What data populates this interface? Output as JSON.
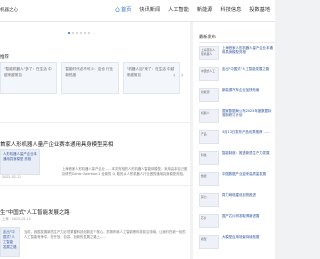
{
  "header": {
    "logo_text": "机器之心",
    "nav": [
      {
        "label": "首页",
        "active": true
      },
      {
        "label": "快讯新闻",
        "active": false
      },
      {
        "label": "人工智能",
        "active": false
      },
      {
        "label": "新能源",
        "active": false
      },
      {
        "label": "科技信息",
        "active": false
      },
      {
        "label": "投数基地",
        "active": false
      }
    ]
  },
  "main": {
    "section_label": "推荐",
    "carousel": [
      {
        "caption": "\"智能机器人\"多了：在生活 中越来越常见"
      },
      {
        "caption": "智能时代必不可少：这也 行业新热度"
      },
      {
        "caption": "\"机器人加\"来了：在生活 中越来越常见"
      }
    ],
    "articles": [
      {
        "title": "首家人形机器人量产企业赛本通用具身模型亮相",
        "thumb_caption": "人形机器人量产企业本通用具身模型 亮相",
        "meta": "2025-02-11",
        "summary": "上海首家人形机器人量产企业……本次亮相的人形机器人智能体模型，采用由本自己团队研究Genie Operator-1 全新的 以  取的从人形机器人行业做的通用具身模型亮相。"
      },
      {
        "title": "生\"中国式\"人工智能发展之路",
        "thumb_caption": "走出\"中国式\"人工智能 发展之路",
        "meta": "上海 · 2025-02-11",
        "summary": "当前，我国发展新质生产力必须紧握科技创新这个核心，抓紧布局人工智能等科技前沿领域，让我们在新一轮的人工智能竞争中，在开放、包容、创新的发展之路上……"
      }
    ]
  },
  "sidebar": {
    "heading": "最新发布",
    "items": [
      {
        "thumb": "上海首家人形机器人",
        "text": "上海首家人形机器人量产企业本通用具身模型亮相"
      },
      {
        "thumb": "中国式人工",
        "text": "走出\"中国式\"人工智能发展之路"
      },
      {
        "thumb": "新能源",
        "text": "新能源汽车企业加快布局"
      },
      {
        "thumb": "机器人",
        "text": "国家数据局公布2025年度数据标准制修订计划"
      },
      {
        "thumb": "产品",
        "text": "3月13日发布产品优秀推荐 ……"
      },
      {
        "thumb": "科技",
        "text": "智能制造：推进新质生产力发展"
      },
      {
        "thumb": "数据",
        "text": "中国数据产业迎来高质量发展"
      },
      {
        "thumb": "算力",
        "text": "算力网络建设加快推进"
      },
      {
        "thumb": "芯片",
        "text": "国产芯片研发取得新进展"
      },
      {
        "thumb": "模型",
        "text": "大模型应用场景持续拓展"
      }
    ]
  }
}
